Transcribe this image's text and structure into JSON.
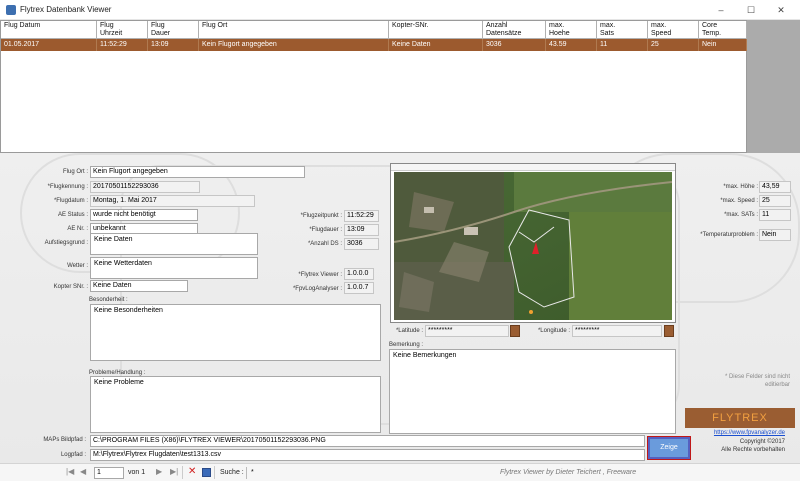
{
  "window": {
    "title": "Flytrex Datenbank Viewer",
    "min": "–",
    "max": "☐",
    "close": "✕"
  },
  "grid": {
    "columns": [
      "Flug Datum",
      "Flug\nUhrzeit",
      "Flug\nDauer",
      "Flug Ort",
      "Kopter-SNr.",
      "Anzahl\nDatensätze",
      "max.\nHoehe",
      "max.\nSats",
      "max.\nSpeed",
      "Core\nTemp."
    ],
    "row": [
      "01.05.2017",
      "11:52:29",
      "13:09",
      "Kein Flugort angegeben",
      "Keine Daten",
      "3036",
      "43.59",
      "11",
      "25",
      "Nein"
    ]
  },
  "form": {
    "flugort": {
      "label": "Flug Ort :",
      "value": "Kein Flugort angegeben"
    },
    "flugkennung": {
      "label": "*Flugkennung :",
      "value": "20170501152293036"
    },
    "flugdatum": {
      "label": "*Flugdatum :",
      "value": "Montag, 1. Mai 2017"
    },
    "ae_status": {
      "label": "AE Status :",
      "value": "wurde nicht benötigt"
    },
    "ae_nr": {
      "label": "AE Nr. :",
      "value": "unbekannt"
    },
    "aufstiegsgrund": {
      "label": "Aufstiegsgrund :",
      "value": "Keine Daten"
    },
    "wetter": {
      "label": "Wetter :",
      "value": "Keine Wetterdaten"
    },
    "kopter_snr": {
      "label": "Kopter SNr. :",
      "value": "Keine Daten"
    },
    "besonderheit": {
      "label": "Besonderheit :",
      "value": "Keine Besonderheiten"
    },
    "probleme": {
      "label": "Probleme/Handlung :",
      "value": "Keine Probleme"
    },
    "flugzeitpunkt": {
      "label": "*Flugzeitpunkt :",
      "value": "11:52:29"
    },
    "flugdauer": {
      "label": "*Flugdauer :",
      "value": "13:09"
    },
    "anzahl_ds": {
      "label": "*Anzahl DS :",
      "value": "3036"
    },
    "flytrex_viewer": {
      "label": "*Flytrex Viewer :",
      "value": "1.0.0.0"
    },
    "fpv_analyser": {
      "label": "*FpvLogAnalyser :",
      "value": "1.0.0.7"
    },
    "latitude": {
      "label": "*Latitude :",
      "value": "*********"
    },
    "longitude": {
      "label": "*Longitude :",
      "value": "*********"
    },
    "bemerkung": {
      "label": "Bemerkung :",
      "value": "Keine Bemerkungen"
    },
    "max_hoehe": {
      "label": "*max. Höhe :",
      "value": "43,59"
    },
    "max_speed": {
      "label": "*max. Speed :",
      "value": "25"
    },
    "max_sats": {
      "label": "*max. SATs :",
      "value": "11"
    },
    "temperaturproblem": {
      "label": "*Temperaturproblem :",
      "value": "Nein"
    },
    "hint": "* Diese Felder sind nicht\neditierbar",
    "maps_bildpfad": {
      "label": "MAPs Bildpfad :",
      "value": "C:\\PROGRAM FILES (X86)\\FLYTREX VIEWER\\20170501152293036.PNG"
    },
    "logpfad": {
      "label": "Logpfad :",
      "value": "M:\\Flytrex\\Flytrex Flugdaten\\test1313.csv"
    },
    "zeige": "Zeige"
  },
  "branding": {
    "logo": "FLYTREX",
    "link": "https://www.fpvanalyzer.de",
    "copyright": "Copyright ©2017",
    "rights": "Alle Rechte vorbehalten",
    "credit": "Flytrex Viewer  by Dieter Teichert , Freeware"
  },
  "nav": {
    "page": "1",
    "of": "von 1",
    "search_label": "Suche :",
    "search_value": "*"
  },
  "colors": {
    "selected_row": "#9c5a2e",
    "zeige_border": "#5560c0",
    "zeige_fill": "#6a9bdc",
    "logo_bg": "#9a5d32",
    "logo_text": "#f2a040"
  }
}
